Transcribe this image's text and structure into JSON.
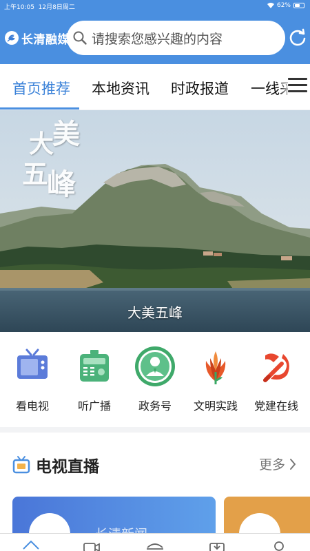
{
  "status": {
    "time": "上午10:05",
    "date": "12月8日周二",
    "battery": "62%",
    "battery_level": 0.62
  },
  "brand": {
    "name": "长清融媒",
    "logo": "leaf-e-logo"
  },
  "search": {
    "placeholder": "请搜索您感兴趣的内容",
    "icon": "search-icon"
  },
  "tabs": [
    "首页推荐",
    "本地资讯",
    "时政报道",
    "一线采"
  ],
  "active_tab": 0,
  "banner": {
    "caption": "大美五峰",
    "calligraphy": [
      "大",
      "美",
      "五",
      "峰"
    ]
  },
  "quick": [
    {
      "label": "看电视",
      "icon": "tv-icon"
    },
    {
      "label": "听广播",
      "icon": "radio-icon"
    },
    {
      "label": "政务号",
      "icon": "person-icon"
    },
    {
      "label": "文明实践",
      "icon": "flame-icon"
    },
    {
      "label": "党建在线",
      "icon": "party-emblem-icon"
    }
  ],
  "live": {
    "title": "电视直播",
    "more": "更多",
    "card1_text": "长清新闻"
  },
  "colors": {
    "brand_blue": "#4a8fe0",
    "active_tab": "#3b82d8",
    "card_orange": "#e3a049"
  }
}
